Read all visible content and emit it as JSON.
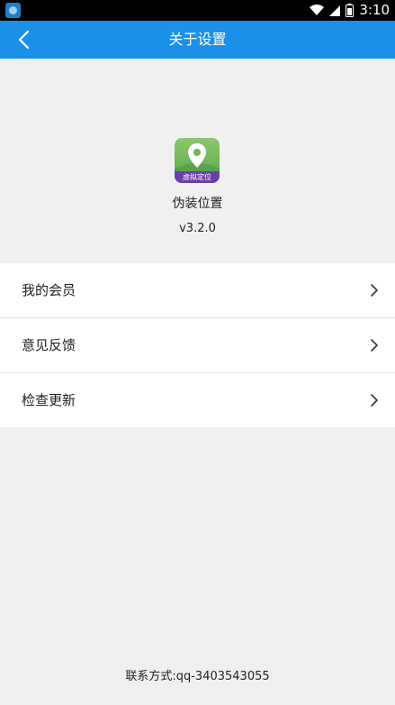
{
  "status_bar": {
    "time": "3:10",
    "app_icon": "location-app-icon",
    "wifi_icon": "wifi-icon",
    "signal_icon": "signal-icon",
    "battery_icon": "battery-icon"
  },
  "toolbar": {
    "title": "关于设置",
    "back_icon": "back-arrow-icon",
    "color": "#1a90e8"
  },
  "app": {
    "icon_text": "虚拟定位",
    "name": "伪装位置",
    "version": "v3.2.0"
  },
  "menu": {
    "items": [
      {
        "label": "我的会员",
        "icon": "chevron-right-icon"
      },
      {
        "label": "意见反馈",
        "icon": "chevron-right-icon"
      },
      {
        "label": "检查更新",
        "icon": "chevron-right-icon"
      }
    ]
  },
  "footer": {
    "contact": "联系方式:qq-3403543055"
  }
}
